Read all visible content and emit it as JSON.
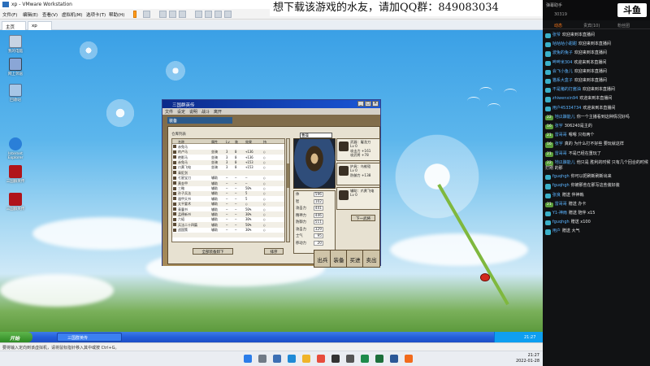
{
  "vm": {
    "title": "xp - VMware Workstation",
    "menu": [
      "文件(F)",
      "编辑(E)",
      "查看(V)",
      "虚拟机(M)",
      "选项卡(T)",
      "帮助(H)"
    ],
    "tabs": [
      "主页",
      "xp"
    ],
    "status": "要将输入定向到该虚拟机，请将鼠标指针移入其中或按 Ctrl+G。"
  },
  "banner": "想下载该游戏的水友，请加QQ群：849083034",
  "desktop_icons": [
    "我的电脑",
    "网上邻居",
    "回收站",
    "Internet Explorer",
    "三国群英传",
    "三国群英传"
  ],
  "xp_taskbar": {
    "start": "开始",
    "task": "三国群英传",
    "clock": "21:27"
  },
  "game": {
    "title": "三国群英传",
    "menu": [
      "文件",
      "设定",
      "说明",
      "战斗",
      "离开"
    ],
    "panel_title": "装备",
    "list_title": "仓库列表",
    "hero": "曹操",
    "columns": [
      "名称",
      "属性",
      "Lv",
      "装",
      "效果",
      "持"
    ],
    "rows": [
      [
        "赤兔马",
        "",
        "",
        "",
        "",
        ""
      ],
      [
        "的卢马",
        "坐骑",
        "3",
        "0",
        "+136",
        "○"
      ],
      [
        "绝影马",
        "坐骑",
        "3",
        "0",
        "+136",
        "○"
      ],
      [
        "赤兔马",
        "坐骑",
        "3",
        "0",
        "+153",
        "○"
      ],
      [
        "爪黄飞电",
        "坐骑",
        "3",
        "0",
        "+153",
        "○"
      ],
      [
        "青釭剑",
        "",
        "",
        "",
        "",
        ""
      ],
      [
        "七星宝刀",
        "辅助",
        "—",
        "—",
        "—",
        "○"
      ],
      [
        "黄金甲",
        "辅助",
        "—",
        "—",
        "—",
        "○"
      ],
      [
        "三略",
        "辅助",
        "—",
        "—",
        "50%",
        "○"
      ],
      [
        "孙子兵法",
        "辅助",
        "—",
        "—",
        "5",
        "○"
      ],
      [
        "遁甲天书",
        "辅助",
        "—",
        "—",
        "5",
        "○"
      ],
      [
        "太平要术",
        "辅助",
        "—",
        "—",
        "○",
        "○"
      ],
      [
        "青囊书",
        "辅助",
        "—",
        "—",
        "50%",
        "○"
      ],
      [
        "孟德新书",
        "辅助",
        "—",
        "—",
        "30%",
        "○"
      ],
      [
        "六韬",
        "辅助",
        "—",
        "—",
        "30%",
        "○"
      ],
      [
        "兵法二十四篇",
        "辅助",
        "—",
        "—",
        "50%",
        "○"
      ],
      [
        "战国策",
        "辅助",
        "—",
        "—",
        "30%",
        "○"
      ],
      [
        "",
        "",
        "",
        "",
        "",
        ""
      ],
      [
        "",
        "",
        "",
        "",
        "",
        ""
      ]
    ],
    "sort_buttons": [
      "全部装备卸下",
      "排序"
    ],
    "slots": [
      {
        "label": "武器：屠龙刀",
        "l2": "Lv 0",
        "l3": "攻击力 +161",
        "l4": "攻武将 +78"
      },
      {
        "label": "护具：乌锥铠",
        "l2": "Lv 0",
        "l3": "防御力 +138",
        "l4": ""
      },
      {
        "label": "辅助：爪黄飞电",
        "l2": "Lv 0",
        "l3": "",
        "l4": ""
      }
    ],
    "stats": [
      {
        "k": "体",
        "v": "596"
      },
      {
        "k": "智",
        "v": "102"
      },
      {
        "k": "攻击力",
        "v": "441"
      },
      {
        "k": "精神力",
        "v": "446"
      },
      {
        "k": "防御力",
        "v": "511"
      },
      {
        "k": "攻击力",
        "v": "329"
      },
      {
        "k": "士气",
        "v": "95"
      },
      {
        "k": "移动力",
        "v": "20"
      }
    ],
    "actions": [
      "出兵",
      "装备",
      "买进",
      "卖出"
    ],
    "next_btn": "下一武将"
  },
  "w11": {
    "time": "21:27",
    "date": "2022-01-28"
  },
  "chat": {
    "title": "弹幕助手",
    "viewers": "30319",
    "logo": "斗鱼",
    "tabs": [
      "动态",
      "贵宾(10)",
      "粉丝团"
    ],
    "messages": [
      {
        "badge": "",
        "user": "张爷",
        "text": "欢迎来到本直播间"
      },
      {
        "badge": "",
        "user": "咕咕咕小甜甜",
        "text": "欢迎来到本直播间"
      },
      {
        "badge": "",
        "user": "波兔的兔子",
        "text": "欢迎来到本直播间"
      },
      {
        "badge": "",
        "user": "哔哔米304",
        "text": "欢迎来到本直播间"
      },
      {
        "badge": "",
        "user": "会飞小鱼儿",
        "text": "欢迎来到本直播间"
      },
      {
        "badge": "",
        "user": "猫系大盒子",
        "text": "欢迎来到本直播间"
      },
      {
        "badge": "",
        "user": "不是猪的打酱油",
        "text": "欢迎来到本直播间"
      },
      {
        "badge": "",
        "user": "zhiwenxin94",
        "text": "欢迎来到本直播间"
      },
      {
        "badge": "",
        "user": "用户45334734",
        "text": "欢迎来到本直播间"
      },
      {
        "badge": "22",
        "user": "地瓜酿能儿",
        "text": "你一个主播看到这种情况好吗"
      },
      {
        "badge": "16",
        "user": "张宇",
        "text": "306240是主的"
      },
      {
        "badge": "21",
        "user": "雷哥哥",
        "text": "嗯嗯 只有两个"
      },
      {
        "badge": "16",
        "user": "张宇",
        "text": "真的 为什么打不好些 要玩就这样"
      },
      {
        "badge": "21",
        "user": "雷哥哥",
        "text": "不是已经在重玩了"
      },
      {
        "badge": "22",
        "user": "地瓜酿能儿",
        "text": "他只是 胜利的时候 只有几个回合的时候 打刚 的那"
      },
      {
        "badge": "",
        "user": "fguqhgh",
        "text": "你可以把刷新刷新出来"
      },
      {
        "badge": "",
        "user": "fguqhgh",
        "text": "你被那些在那写这些装好装"
      },
      {
        "badge": "",
        "user": "张良",
        "text": "赠送 伴神戟"
      },
      {
        "badge": "21",
        "user": "雷哥哥",
        "text": "赠送 办卡"
      },
      {
        "badge": "",
        "user": "Y1-神雨",
        "text": "赠送 陪伴 x15"
      },
      {
        "badge": "",
        "user": "fguqhgh",
        "text": "赠送 x100"
      },
      {
        "badge": "",
        "user": "用户",
        "text": "赠送 大气"
      }
    ]
  }
}
